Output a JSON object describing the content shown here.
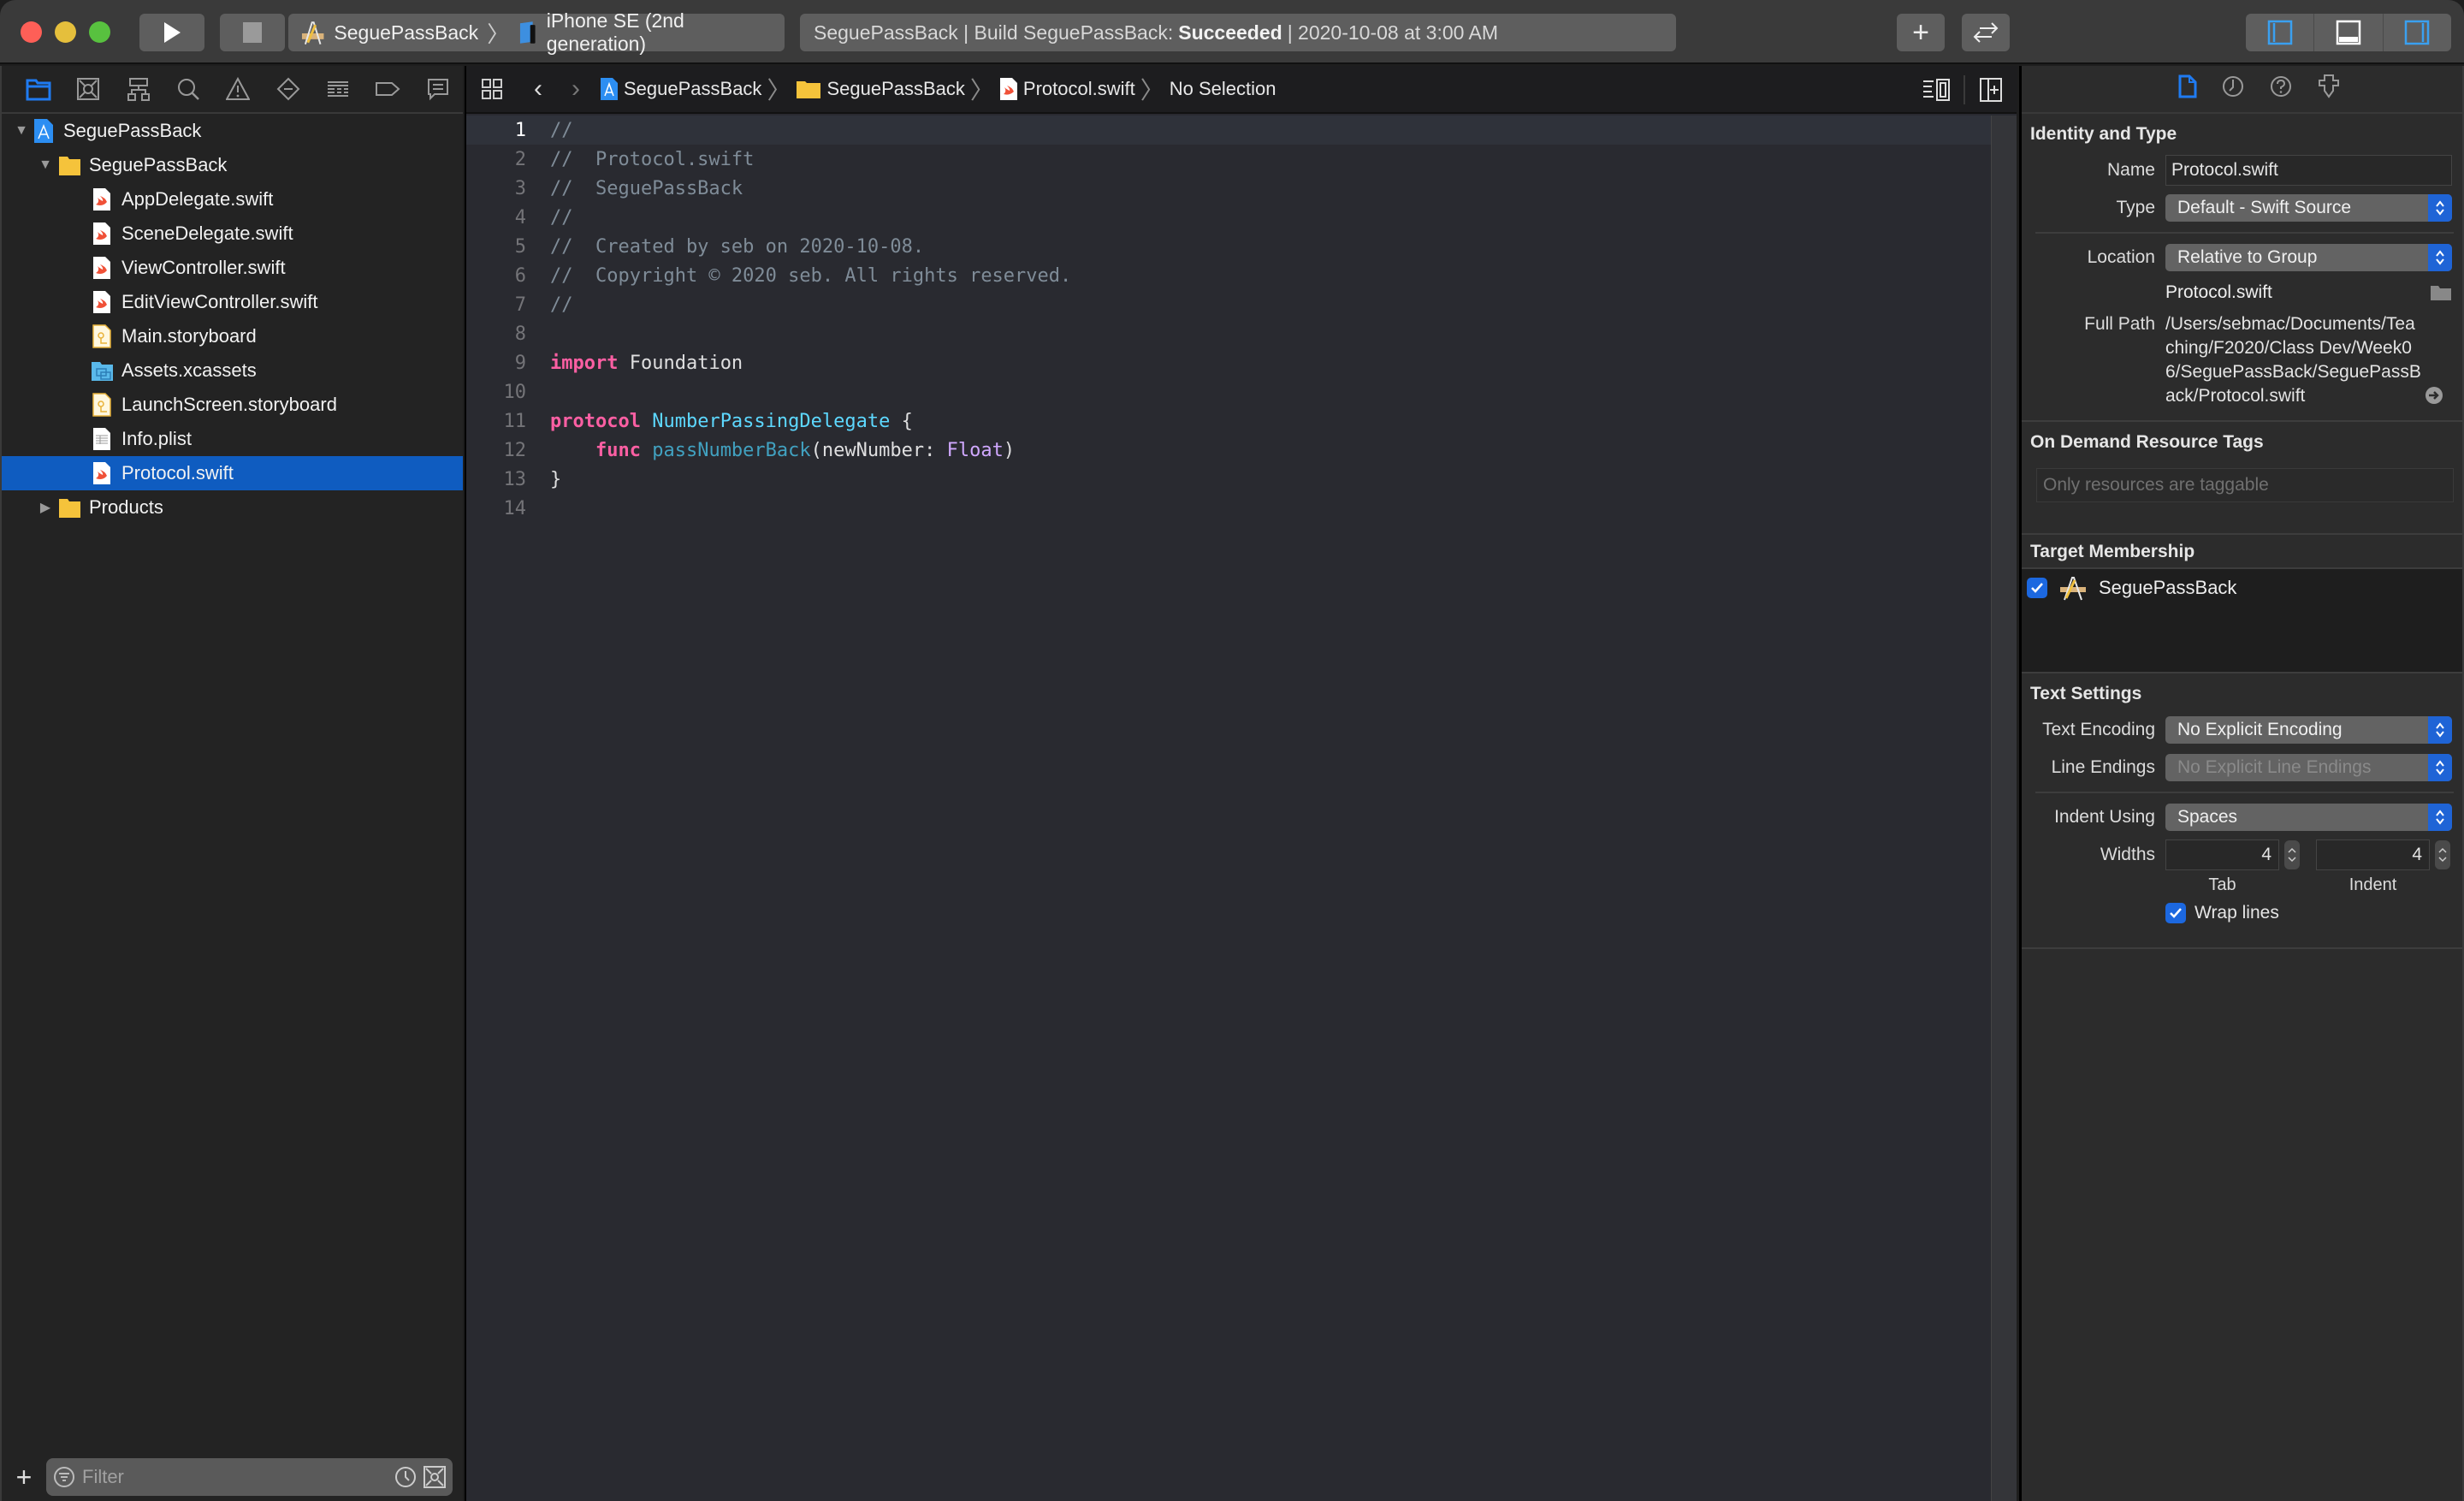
{
  "toolbar": {
    "scheme_target": "SeguePassBack",
    "scheme_device": "iPhone SE (2nd generation)",
    "activity_prefix": "SeguePassBack | Build SeguePassBack:",
    "activity_status": "Succeeded",
    "activity_suffix": "| 2020-10-08 at 3:00 AM",
    "icons": {
      "run": "play-icon",
      "stop": "stop-icon",
      "add": "plus-icon",
      "review": "code-review-icon",
      "layout": [
        "navigator-toggle-icon",
        "debug-area-toggle-icon",
        "inspector-toggle-icon"
      ]
    }
  },
  "navigator": {
    "tabs": [
      "project-navigator-icon",
      "source-control-icon",
      "symbol-navigator-icon",
      "find-icon",
      "issue-icon",
      "test-icon",
      "debug-icon",
      "breakpoint-icon",
      "report-icon"
    ],
    "tree": [
      {
        "label": "SeguePassBack",
        "kind": "project",
        "depth": 0,
        "expanded": true
      },
      {
        "label": "SeguePassBack",
        "kind": "folder",
        "depth": 1,
        "expanded": true
      },
      {
        "label": "AppDelegate.swift",
        "kind": "swift",
        "depth": 2
      },
      {
        "label": "SceneDelegate.swift",
        "kind": "swift",
        "depth": 2
      },
      {
        "label": "ViewController.swift",
        "kind": "swift",
        "depth": 2
      },
      {
        "label": "EditViewController.swift",
        "kind": "swift",
        "depth": 2
      },
      {
        "label": "Main.storyboard",
        "kind": "storyboard",
        "depth": 2
      },
      {
        "label": "Assets.xcassets",
        "kind": "assets",
        "depth": 2
      },
      {
        "label": "LaunchScreen.storyboard",
        "kind": "storyboard",
        "depth": 2
      },
      {
        "label": "Info.plist",
        "kind": "plist",
        "depth": 2
      },
      {
        "label": "Protocol.swift",
        "kind": "swift",
        "depth": 2,
        "selected": true
      },
      {
        "label": "Products",
        "kind": "folder",
        "depth": 1,
        "expanded": false
      }
    ],
    "filter_placeholder": "Filter"
  },
  "editor": {
    "jumpbar": [
      "SeguePassBack",
      "SeguePassBack",
      "Protocol.swift",
      "No Selection"
    ],
    "current_line": 1,
    "lines": [
      [
        {
          "t": "//",
          "c": "comment"
        }
      ],
      [
        {
          "t": "//  Protocol.swift",
          "c": "comment"
        }
      ],
      [
        {
          "t": "//  SeguePassBack",
          "c": "comment"
        }
      ],
      [
        {
          "t": "//",
          "c": "comment"
        }
      ],
      [
        {
          "t": "//  Created by seb on 2020-10-08.",
          "c": "comment"
        }
      ],
      [
        {
          "t": "//  Copyright © 2020 seb. All rights reserved.",
          "c": "comment"
        }
      ],
      [
        {
          "t": "//",
          "c": "comment"
        }
      ],
      [],
      [
        {
          "t": "import",
          "c": "kw"
        },
        {
          "t": " Foundation",
          "c": "plain"
        }
      ],
      [],
      [
        {
          "t": "protocol",
          "c": "kw"
        },
        {
          "t": " ",
          "c": "plain"
        },
        {
          "t": "NumberPassingDelegate",
          "c": "type"
        },
        {
          "t": " {",
          "c": "plain"
        }
      ],
      [
        {
          "t": "    ",
          "c": "plain"
        },
        {
          "t": "func",
          "c": "kw"
        },
        {
          "t": " ",
          "c": "plain"
        },
        {
          "t": "passNumberBack",
          "c": "func"
        },
        {
          "t": "(newNumber: ",
          "c": "plain"
        },
        {
          "t": "Float",
          "c": "systype"
        },
        {
          "t": ")",
          "c": "plain"
        }
      ],
      [
        {
          "t": "}",
          "c": "plain"
        }
      ],
      []
    ]
  },
  "inspector": {
    "tabs": [
      "file-inspector-icon",
      "history-icon",
      "quick-help-icon",
      "accessibility-icon"
    ],
    "identity": {
      "title": "Identity and Type",
      "name_label": "Name",
      "name_value": "Protocol.swift",
      "type_label": "Type",
      "type_value": "Default - Swift Source",
      "location_label": "Location",
      "location_value": "Relative to Group",
      "location_file": "Protocol.swift",
      "full_path_label": "Full Path",
      "full_path_value": "/Users/sebmac/Documents/Teaching/F2020/Class Dev/Week06/SeguePassBack/SeguePassBack/Protocol.swift"
    },
    "odr": {
      "title": "On Demand Resource Tags",
      "placeholder": "Only resources are taggable"
    },
    "membership": {
      "title": "Target Membership",
      "targets": [
        {
          "name": "SeguePassBack",
          "checked": true
        }
      ]
    },
    "text_settings": {
      "title": "Text Settings",
      "encoding_label": "Text Encoding",
      "encoding_value": "No Explicit Encoding",
      "line_endings_label": "Line Endings",
      "line_endings_value": "No Explicit Line Endings",
      "indent_using_label": "Indent Using",
      "indent_using_value": "Spaces",
      "widths_label": "Widths",
      "tab_width": "4",
      "indent_width": "4",
      "tab_label": "Tab",
      "indent_label": "Indent",
      "wrap_lines_label": "Wrap lines",
      "wrap_lines": true
    }
  },
  "colors": {
    "accent": "#1c68e0",
    "selection": "#0f5cc0",
    "keyword": "#fc5fa3",
    "type": "#5dd8ff",
    "function": "#41a1c0",
    "system_type": "#d0a8ff",
    "comment": "#7f8c98"
  }
}
